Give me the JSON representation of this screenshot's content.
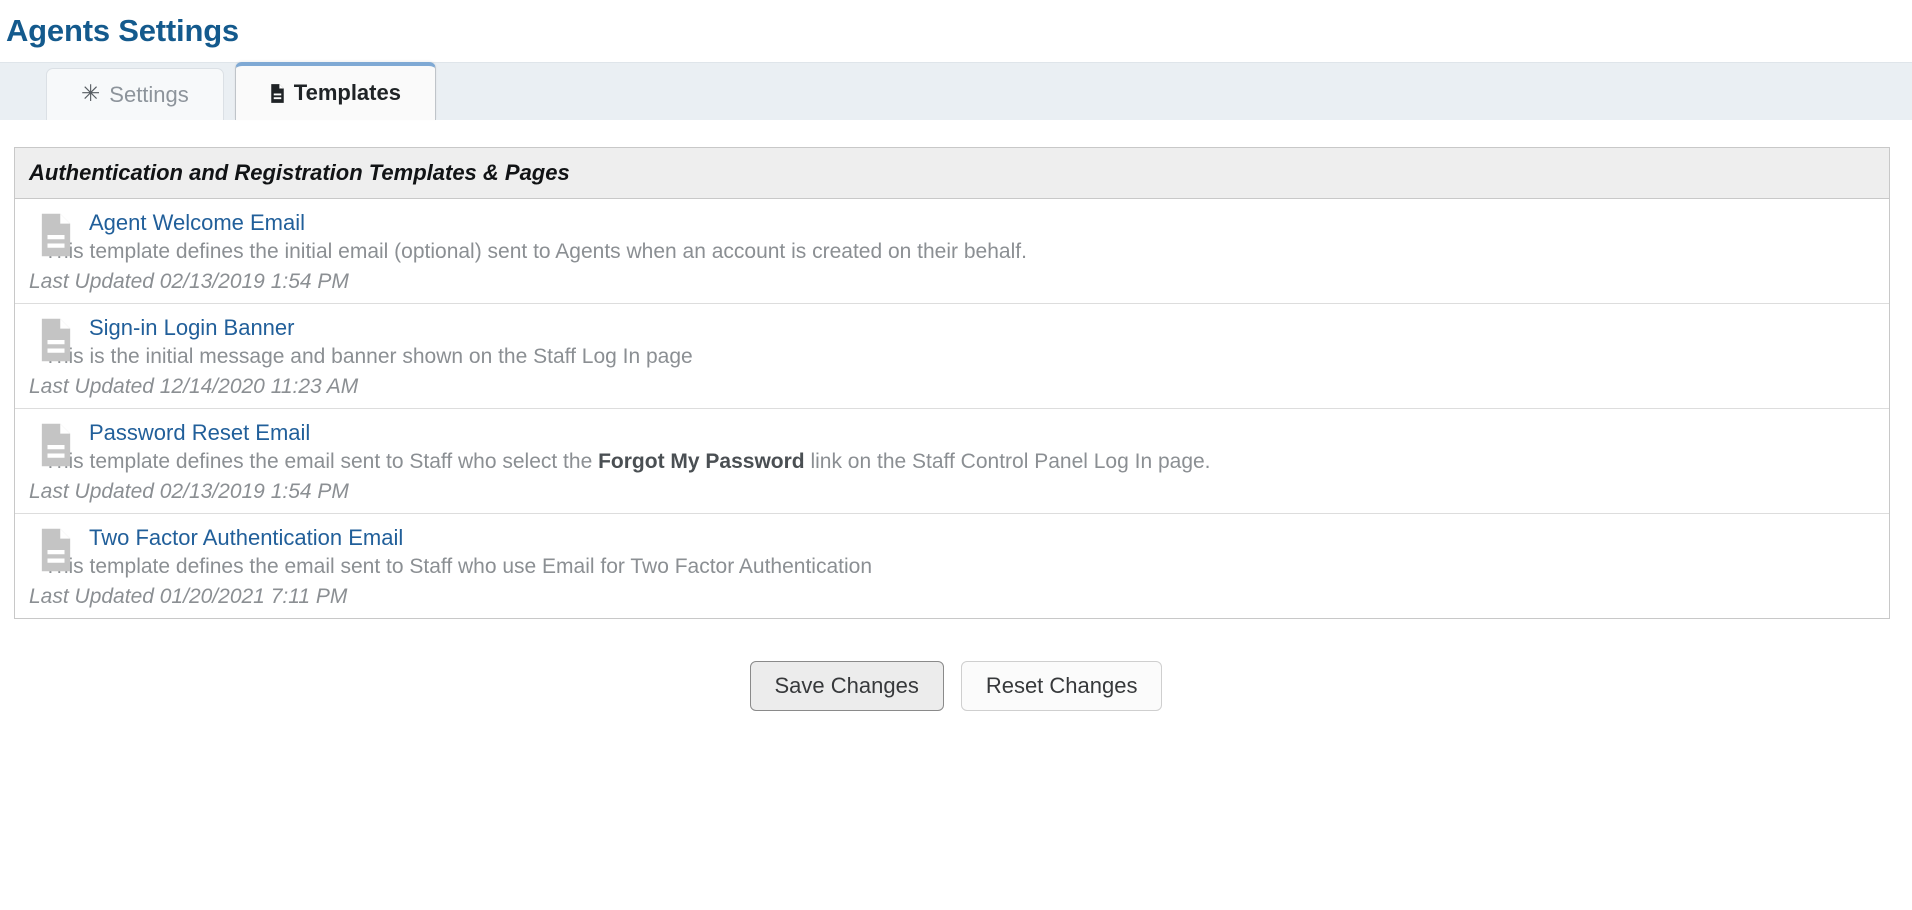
{
  "page": {
    "title": "Agents Settings"
  },
  "tabs": [
    {
      "label": "Settings",
      "icon": "asterisk-icon",
      "active": false
    },
    {
      "label": "Templates",
      "icon": "document-icon",
      "active": true
    }
  ],
  "panel": {
    "header": "Authentication and Registration Templates & Pages",
    "rows": [
      {
        "icon": "document-icon",
        "link": "Agent Welcome Email",
        "desc_before": "This template defines the initial email (optional) sent to Agents when an account is created on their behalf.",
        "desc_bold": "",
        "desc_after": "",
        "updated": "Last Updated 02/13/2019 1:54 PM"
      },
      {
        "icon": "document-icon",
        "link": "Sign-in Login Banner",
        "desc_before": "This is the initial message and banner shown on the Staff Log In page",
        "desc_bold": "",
        "desc_after": "",
        "updated": "Last Updated 12/14/2020 11:23 AM"
      },
      {
        "icon": "document-icon",
        "link": "Password Reset Email",
        "desc_before": "This template defines the email sent to Staff who select the ",
        "desc_bold": "Forgot My Password",
        "desc_after": " link on the Staff Control Panel Log In page.",
        "updated": "Last Updated 02/13/2019 1:54 PM"
      },
      {
        "icon": "document-icon",
        "link": "Two Factor Authentication Email",
        "desc_before": "This template defines the email sent to Staff who use Email for Two Factor Authentication",
        "desc_bold": "",
        "desc_after": "",
        "updated": "Last Updated 01/20/2021 7:11 PM"
      }
    ]
  },
  "footer": {
    "save_label": "Save Changes",
    "reset_label": "Reset Changes"
  },
  "colors": {
    "title": "#145a8d",
    "link": "#215f9a",
    "muted": "#8b8f93",
    "tab_active_top": "#7fa9d4",
    "panel_header_bg": "#eeeeee",
    "tabstrip_bg": "#eaeff3"
  }
}
